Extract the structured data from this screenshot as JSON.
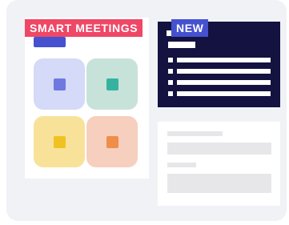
{
  "badges": {
    "primary": "SMART MEETINGS",
    "secondary": "NEW"
  },
  "colors": {
    "card_background": "#f1f2f6",
    "primary_badge": "#ef4766",
    "secondary_badge": "#4551cf",
    "dark_panel": "#131240",
    "tile_blue": "#d4daf7",
    "tile_green": "#c7e2d9",
    "tile_yellow": "#f8e29a",
    "tile_orange": "#f7cfbe"
  }
}
